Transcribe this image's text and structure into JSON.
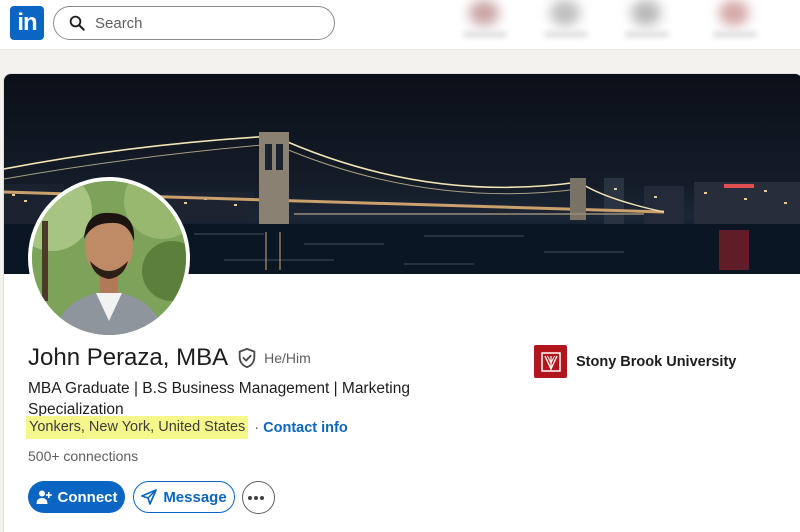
{
  "header": {
    "logo_text": "in",
    "search_placeholder": "Search"
  },
  "profile": {
    "name": "John Peraza, MBA",
    "pronouns": "He/Him",
    "headline": "MBA Graduate | B.S Business Management | Marketing Specialization",
    "location": "Yonkers, New York, United States",
    "separator": "·",
    "contact_info_label": "Contact info",
    "connections": "500+ connections",
    "education": "Stony Brook University"
  },
  "actions": {
    "connect_label": "Connect",
    "message_label": "Message"
  },
  "colors": {
    "brand": "#0a66c2",
    "location_highlight": "#f6f78a",
    "university": "#b2161c"
  }
}
